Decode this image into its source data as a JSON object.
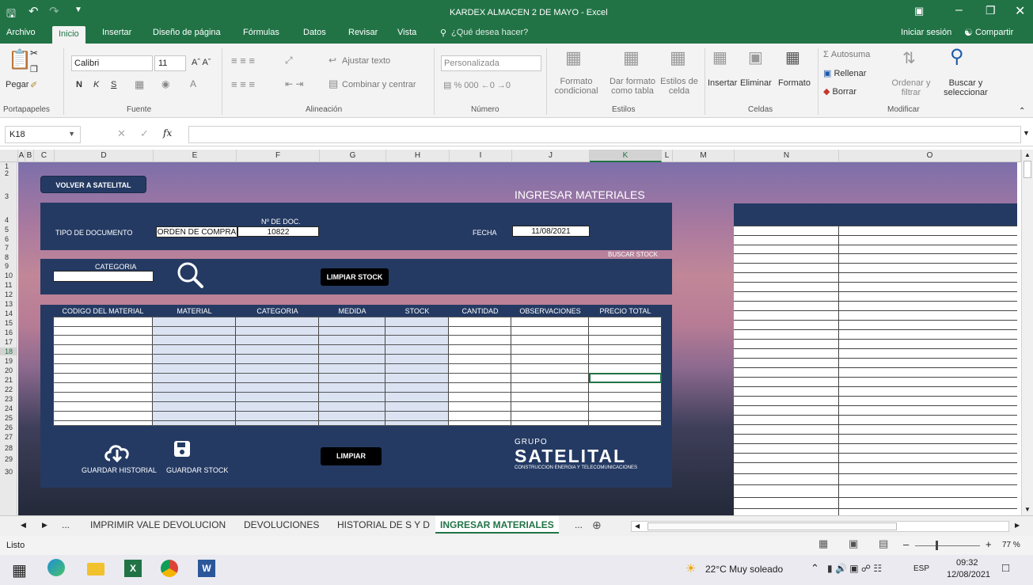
{
  "window": {
    "title": "KARDEX ALMACEN 2 DE MAYO - Excel"
  },
  "ribbon_tabs": [
    "Archivo",
    "Inicio",
    "Insertar",
    "Diseño de página",
    "Fórmulas",
    "Datos",
    "Revisar",
    "Vista"
  ],
  "tell_me": "¿Qué desea hacer?",
  "signin": "Iniciar sesión",
  "share": "Compartir",
  "ribbon": {
    "paste": "Pegar",
    "font_name": "Calibri",
    "font_size": "11",
    "bold": "N",
    "italic": "K",
    "underline": "S",
    "wrap_text": "Ajustar texto",
    "merge_center": "Combinar y centrar",
    "number_format": "Personalizada",
    "cond_format": "Formato condicional",
    "format_table": "Dar formato como tabla",
    "cell_styles": "Estilos de celda",
    "insert": "Insertar",
    "delete": "Eliminar",
    "format": "Formato",
    "autosum": "Autosuma",
    "fill": "Rellenar",
    "clear": "Borrar",
    "sort_filter": "Ordenar y filtrar",
    "find_select": "Buscar y seleccionar",
    "groups": [
      "Portapapeles",
      "Fuente",
      "Alineación",
      "Número",
      "Estilos",
      "Celdas",
      "Modificar"
    ]
  },
  "formula_bar": {
    "name_box": "K18",
    "fx": "fx",
    "content": ""
  },
  "columns": [
    "A",
    "B",
    "C",
    "D",
    "E",
    "F",
    "G",
    "H",
    "I",
    "J",
    "K",
    "L",
    "M",
    "N",
    "O"
  ],
  "rows": [
    "1",
    "2",
    "3",
    "4",
    "5",
    "6",
    "7",
    "8",
    "9",
    "10",
    "11",
    "12",
    "13",
    "14",
    "15",
    "16",
    "17",
    "18",
    "19",
    "20",
    "21",
    "22",
    "23",
    "24",
    "25",
    "26",
    "27",
    "28",
    "29",
    "30"
  ],
  "form": {
    "back_button": "VOLVER A SATELITAL",
    "title": "INGRESAR MATERIALES",
    "doc_type_label": "TIPO DE DOCUMENTO",
    "doc_type_value": "ORDEN DE COMPRA",
    "doc_no_label": "Nº DE DOC.",
    "doc_no_value": "10822",
    "date_label": "FECHA",
    "date_value": "11/08/2021",
    "search_stock": "BUSCAR STOCK",
    "category_label": "CATEGORIA",
    "clear_stock_button": "LIMPIAR STOCK",
    "table_headers": [
      "CODIGO DEL MATERIAL",
      "MATERIAL",
      "CATEGORIA",
      "MEDIDA",
      "STOCK",
      "CANTIDAD",
      "OBSERVACIONES",
      "PRECIO TOTAL"
    ],
    "save_history": "GUARDAR HISTORIAL",
    "save_stock": "GUARDAR STOCK",
    "clear_button": "LIMPIAR",
    "logo_group": "GRUPO",
    "logo_name": "SATELITAL",
    "logo_tagline": "CONSTRUCCION ENERGIA Y TELECOMUNICACIONES"
  },
  "sheet_tabs": [
    "...",
    "IMPRIMIR VALE DEVOLUCION",
    "DEVOLUCIONES",
    "HISTORIAL DE S Y D",
    "INGRESAR MATERIALES",
    "..."
  ],
  "status": {
    "ready": "Listo",
    "zoom": "77 %"
  },
  "taskbar": {
    "weather": "22°C  Muy soleado",
    "lang": "ESP",
    "time": "09:32",
    "date": "12/08/2021"
  },
  "colors": {
    "excel_green": "#217346",
    "navy": "#243a63"
  }
}
